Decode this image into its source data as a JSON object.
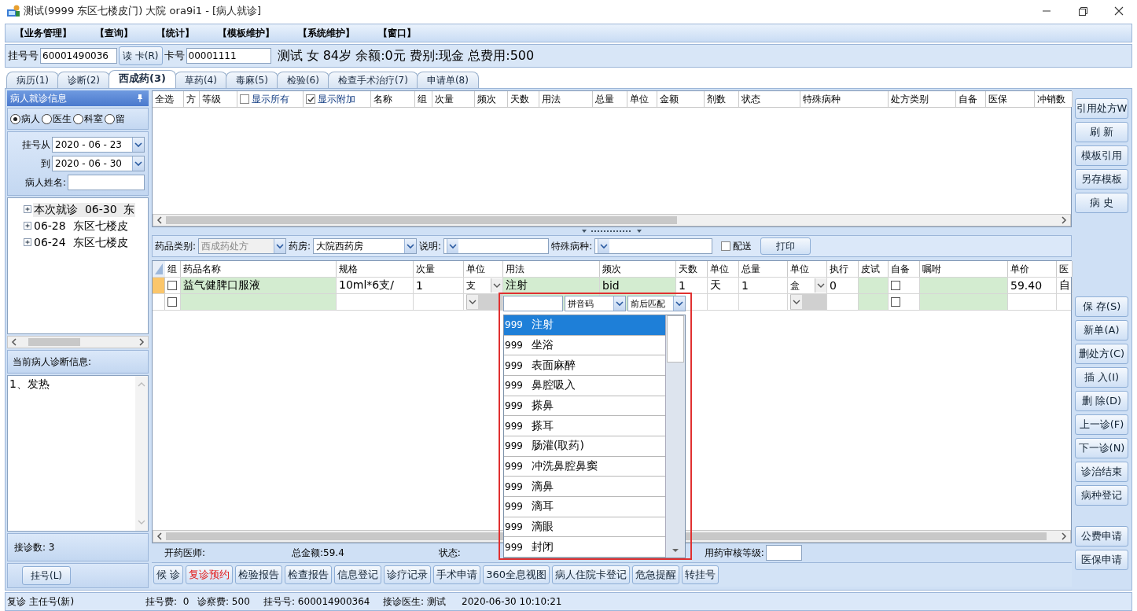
{
  "window": {
    "title": "测试(9999 东区七楼皮门) 大院 ora9i1 - [病人就诊]"
  },
  "menu": [
    "【业务管理】",
    "【查询】",
    "【统计】",
    "【模板维护】",
    "【系统维护】",
    "【窗口】"
  ],
  "patient_bar": {
    "reg_no_label": "挂号号",
    "reg_no": "60001490036",
    "read_card_button": "读 卡(R)",
    "card_label": "卡号",
    "card_no": "00001111",
    "summary": "测试 女 84岁 余额:0元 费别:现金 总费用:500"
  },
  "tabs": [
    {
      "label": "病历(1)",
      "selected": false
    },
    {
      "label": "诊断(2)",
      "selected": false
    },
    {
      "label": "西成药(3)",
      "selected": true
    },
    {
      "label": "草药(4)",
      "selected": false
    },
    {
      "label": "毒麻(5)",
      "selected": false
    },
    {
      "label": "检验(6)",
      "selected": false
    },
    {
      "label": "检查手术治疗(7)",
      "selected": false
    },
    {
      "label": "申请单(8)",
      "selected": false
    }
  ],
  "left_panel": {
    "title": "病人就诊信息",
    "filters": [
      {
        "label": "病人",
        "selected": true
      },
      {
        "label": "医生",
        "selected": false
      },
      {
        "label": "科室",
        "selected": false
      },
      {
        "label": "留",
        "selected": false
      }
    ],
    "reg_from_label": "挂号从",
    "reg_from": "2020 - 06 - 23",
    "reg_to_label": "到",
    "reg_to": "2020 - 06 - 30",
    "name_label": "病人姓名:",
    "visits": [
      {
        "label": "本次就诊  06-30  东",
        "selected": true,
        "expanded": false
      },
      {
        "label": "06-28  东区七楼皮",
        "selected": false,
        "expanded": false
      },
      {
        "label": "06-24  东区七楼皮",
        "selected": false,
        "expanded": false
      }
    ],
    "diagnosis_title": "当前病人诊断信息:",
    "diagnosis": "1、发热",
    "visit_count": "接诊数: 3",
    "register_button": "挂号(L)"
  },
  "prescription_list": {
    "columns": [
      {
        "kind": "label",
        "label": "全选"
      },
      {
        "kind": "label",
        "label": "方"
      },
      {
        "kind": "label",
        "label": "等级"
      },
      {
        "kind": "checkbox",
        "label": "显示所有",
        "checked": false
      },
      {
        "kind": "checkbox",
        "label": "显示附加",
        "checked": true
      },
      {
        "kind": "label",
        "label": "名称"
      },
      {
        "kind": "label",
        "label": "组"
      },
      {
        "kind": "label",
        "label": "次量"
      },
      {
        "kind": "label",
        "label": "频次"
      },
      {
        "kind": "label",
        "label": "天数"
      },
      {
        "kind": "label",
        "label": "用法"
      },
      {
        "kind": "label",
        "label": "总量"
      },
      {
        "kind": "label",
        "label": "单位"
      },
      {
        "kind": "label",
        "label": "金额"
      },
      {
        "kind": "label",
        "label": "剂数"
      },
      {
        "kind": "label",
        "label": "状态"
      },
      {
        "kind": "label",
        "label": "特殊病种"
      },
      {
        "kind": "label",
        "label": "处方类别"
      },
      {
        "kind": "label",
        "label": "自备"
      },
      {
        "kind": "label",
        "label": "医保"
      },
      {
        "kind": "label",
        "label": "冲销数"
      }
    ]
  },
  "drug_toolbar": {
    "fields": [
      {
        "label": "药品类别:",
        "value": "西成药处方",
        "disabled": true
      },
      {
        "label": "药房:",
        "value": "大院西药房",
        "disabled": false
      },
      {
        "label": "说明:",
        "disabled": false
      },
      {
        "label": "特殊病种:",
        "disabled": false
      }
    ],
    "delivery": {
      "label": "配送",
      "checked": false
    },
    "print_button": "打印"
  },
  "drug_grid": {
    "columns": [
      "组",
      "药品名称",
      "规格",
      "次量",
      "单位",
      "用法",
      "频次",
      "天数",
      "单位",
      "总量",
      "单位",
      "执行",
      "皮试",
      "自备",
      "嘱咐",
      "单价",
      "医"
    ],
    "rows": [
      {
        "current": true,
        "group_checked": false,
        "self_supplied": false,
        "name": "益气健脾口服液",
        "spec": "10ml*6支/",
        "dose": "1",
        "unit": "支",
        "usage": "注射",
        "frequency": "bid",
        "days": "1",
        "day_unit": "天",
        "total": "1",
        "pack_unit": "盒",
        "exec": "0",
        "price": "59.40",
        "insurance": "自"
      },
      {
        "current": false,
        "group_checked": false,
        "self_supplied": false
      }
    ]
  },
  "usage_dropdown": {
    "mode": "拼音码",
    "match": "前后匹配",
    "options": [
      {
        "code": "999",
        "label": "注射",
        "selected": true
      },
      {
        "code": "999",
        "label": "坐浴",
        "selected": false
      },
      {
        "code": "999",
        "label": "表面麻醉",
        "selected": false
      },
      {
        "code": "999",
        "label": "鼻腔吸入",
        "selected": false
      },
      {
        "code": "999",
        "label": "搽鼻",
        "selected": false
      },
      {
        "code": "999",
        "label": "搽耳",
        "selected": false
      },
      {
        "code": "999",
        "label": "肠灌(取药)",
        "selected": false
      },
      {
        "code": "999",
        "label": "冲洗鼻腔鼻窦",
        "selected": false
      },
      {
        "code": "999",
        "label": "滴鼻",
        "selected": false
      },
      {
        "code": "999",
        "label": "滴耳",
        "selected": false
      },
      {
        "code": "999",
        "label": "滴眼",
        "selected": false
      },
      {
        "code": "999",
        "label": "封闭",
        "selected": false
      }
    ]
  },
  "summary": {
    "doctor_label": "开药医师:",
    "total": "总金额:59.4",
    "status_label": "状态:",
    "review_label": "用药审核等级:"
  },
  "actions": [
    {
      "label": "候 诊",
      "alert": false
    },
    {
      "label": "复诊预约",
      "alert": true
    },
    {
      "label": "检验报告",
      "alert": false
    },
    {
      "label": "检查报告",
      "alert": false
    },
    {
      "label": "信息登记",
      "alert": false
    },
    {
      "label": "诊疗记录",
      "alert": false
    },
    {
      "label": "手术申请",
      "alert": false
    },
    {
      "label": "360全息视图",
      "alert": false
    },
    {
      "label": "病人住院卡登记",
      "alert": false
    },
    {
      "label": "危急提醒",
      "alert": false
    },
    {
      "label": "转挂号",
      "alert": false
    }
  ],
  "side_buttons": {
    "top": [
      "引用处方W",
      "刷 新",
      "模板引用",
      "另存模板",
      "病 史"
    ],
    "middle": [
      "保 存(S)",
      "新单(A)",
      "删处方(C)",
      "插 入(I)",
      "删 除(D)",
      "上一诊(F)",
      "下一诊(N)",
      "诊治结束",
      "病种登记"
    ],
    "bottom": [
      "公费申请",
      "医保申请"
    ]
  },
  "status_bar": [
    "复诊 主任号(新)",
    "挂号费:  0",
    "诊察费: 500",
    "挂号号: 600014900364",
    "接诊医生: 测试",
    "2020-06-30 10:10:21"
  ]
}
